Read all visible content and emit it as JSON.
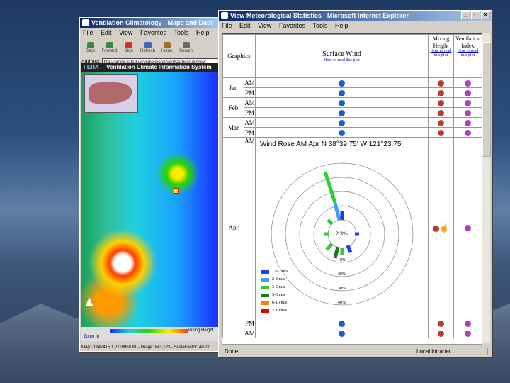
{
  "left_window": {
    "title": "Ventilation Climatology - Maps and Data - Microsoft Internet...",
    "menu": [
      "File",
      "Edit",
      "View",
      "Favorites",
      "Tools",
      "Help"
    ],
    "toolbar": [
      "Back",
      "Forward",
      "Stop",
      "Refresh",
      "Home",
      "Search"
    ],
    "address_label": "Address",
    "address_value": "http://airfire.fs.fed.us/vsmokeproj/VentCarbon/US/view",
    "map_header": "Ventilation Climate Information System",
    "logo_text": "FERA",
    "legend_label": "Mixing Height",
    "zoom_label": "Zoom In",
    "status": "Map: -1947415.1 2110958.81 - Image: 843,123 - ScaleFactor: 40.27"
  },
  "right_window": {
    "title": "View Meteorological Statistics - Microsoft Internet Explorer",
    "menu": [
      "File",
      "Edit",
      "View",
      "Favorites",
      "Tools",
      "Help"
    ],
    "header": {
      "graphics": "Graphics",
      "surface_wind": "Surface Wind",
      "surface_wind_link": "How to read this plot",
      "mixing_height": "Mixing Height",
      "mixing_link": "How to read this plot",
      "vent_index": "Ventilation Index",
      "vent_link": "How to read this plot"
    },
    "months": [
      {
        "name": "Jan",
        "rows": [
          "AM",
          "PM"
        ]
      },
      {
        "name": "Feb",
        "rows": [
          "AM",
          "PM"
        ]
      },
      {
        "name": "Mar",
        "rows": [
          "AM",
          "PM"
        ]
      }
    ],
    "apr": {
      "name": "Apr",
      "row": "AM",
      "rose_title": "Wind Rose   AM   Apr   N 38°39.75' W 121°23.75'",
      "calm_pct": "2.3%",
      "rings": [
        "10%",
        "20%",
        "30%",
        "40%"
      ],
      "speed_legend": [
        {
          "label": "1.0-2 m/s",
          "color": "#1a3cff"
        },
        {
          "label": "2-3 m/s",
          "color": "#3aa0ff"
        },
        {
          "label": "3-5 m/s",
          "color": "#33cc33"
        },
        {
          "label": "5-6 m/s",
          "color": "#1a7a1a"
        },
        {
          "label": "6-10 m/s",
          "color": "#ff7f00"
        },
        {
          "label": "> 10 m/s",
          "color": "#e00000"
        }
      ]
    },
    "bottom_rows": [
      "PM",
      "AM"
    ],
    "colors": {
      "surface": "#1560d8",
      "mixing": "#c0392b",
      "vent": "#b040c0"
    },
    "status_left": "Done",
    "status_right": "Local intranet"
  }
}
